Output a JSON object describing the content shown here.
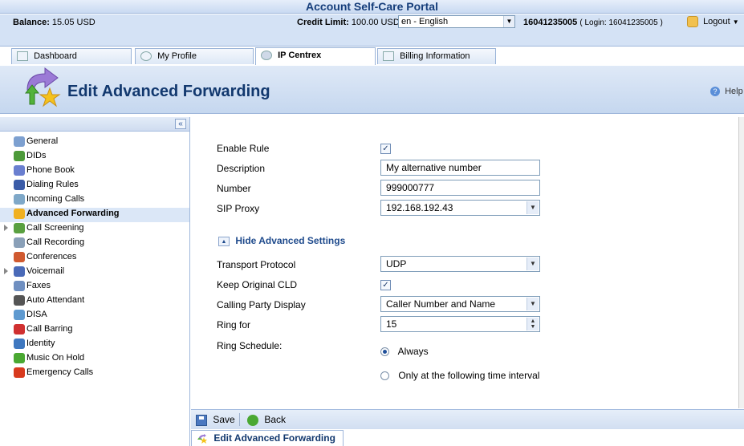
{
  "window": {
    "title": "Account Self-Care Portal"
  },
  "infobar": {
    "balance_label": "Balance:",
    "balance_value": "15.05 USD",
    "credit_label": "Credit Limit:",
    "credit_value": "100.00 USD",
    "language": "en - English",
    "account_number": "16041235005",
    "login_text": "( Login: 16041235005 )",
    "logout_label": "Logout"
  },
  "tabs": [
    {
      "label": "Dashboard",
      "icon": "dashboard-icon",
      "active": false
    },
    {
      "label": "My Profile",
      "icon": "user-icon",
      "active": false
    },
    {
      "label": "IP Centrex",
      "icon": "gear-icon",
      "active": true
    },
    {
      "label": "Billing Information",
      "icon": "document-icon",
      "active": false
    }
  ],
  "header": {
    "title": "Edit Advanced Forwarding",
    "help_label": "Help"
  },
  "sidebar": {
    "items": [
      {
        "label": "General",
        "icon": "gear-icon",
        "color": "#7da0d0",
        "expandable": false,
        "active": false
      },
      {
        "label": "DIDs",
        "icon": "network-icon",
        "color": "#4d9a3a",
        "expandable": false,
        "active": false
      },
      {
        "label": "Phone Book",
        "icon": "phonebook-icon",
        "color": "#6a7fd0",
        "expandable": false,
        "active": false
      },
      {
        "label": "Dialing Rules",
        "icon": "dialpad-icon",
        "color": "#3b5ca8",
        "expandable": false,
        "active": false
      },
      {
        "label": "Incoming Calls",
        "icon": "incoming-call-icon",
        "color": "#7fa8c8",
        "expandable": false,
        "active": false
      },
      {
        "label": "Advanced Forwarding",
        "icon": "forwarding-icon",
        "color": "#f0b020",
        "expandable": false,
        "active": true
      },
      {
        "label": "Call Screening",
        "icon": "screening-icon",
        "color": "#5aa040",
        "expandable": true,
        "active": false
      },
      {
        "label": "Call Recording",
        "icon": "recording-icon",
        "color": "#8aa0b8",
        "expandable": false,
        "active": false
      },
      {
        "label": "Conferences",
        "icon": "conference-icon",
        "color": "#d05a30",
        "expandable": false,
        "active": false
      },
      {
        "label": "Voicemail",
        "icon": "voicemail-icon",
        "color": "#4a6ab8",
        "expandable": true,
        "active": false
      },
      {
        "label": "Faxes",
        "icon": "fax-icon",
        "color": "#6f8fc0",
        "expandable": false,
        "active": false
      },
      {
        "label": "Auto Attendant",
        "icon": "attendant-icon",
        "color": "#555555",
        "expandable": false,
        "active": false
      },
      {
        "label": "DISA",
        "icon": "disa-icon",
        "color": "#5f9ad0",
        "expandable": false,
        "active": false
      },
      {
        "label": "Call Barring",
        "icon": "barring-icon",
        "color": "#d03030",
        "expandable": false,
        "active": false
      },
      {
        "label": "Identity",
        "icon": "identity-icon",
        "color": "#3f78c0",
        "expandable": false,
        "active": false
      },
      {
        "label": "Music On Hold",
        "icon": "music-icon",
        "color": "#4aa832",
        "expandable": false,
        "active": false
      },
      {
        "label": "Emergency Calls",
        "icon": "emergency-icon",
        "color": "#d83a1e",
        "expandable": false,
        "active": false
      }
    ]
  },
  "form": {
    "enable_rule_label": "Enable Rule",
    "enable_rule_checked": true,
    "description_label": "Description",
    "description_value": "My alternative number",
    "number_label": "Number",
    "number_value": "999000777",
    "sip_proxy_label": "SIP Proxy",
    "sip_proxy_value": "192.168.192.43",
    "advanced_toggle_label": "Hide Advanced Settings",
    "transport_label": "Transport Protocol",
    "transport_value": "UDP",
    "keep_cld_label": "Keep Original CLD",
    "keep_cld_checked": true,
    "calling_party_label": "Calling Party Display",
    "calling_party_value": "Caller Number and Name",
    "ring_for_label": "Ring for",
    "ring_for_value": "15",
    "ring_schedule_label": "Ring Schedule:",
    "schedule_always_label": "Always",
    "schedule_interval_label": "Only at the following time interval",
    "schedule_selected": "always"
  },
  "toolbar": {
    "save_label": "Save",
    "back_label": "Back"
  },
  "bottom_tab": {
    "label": "Edit Advanced Forwarding"
  }
}
